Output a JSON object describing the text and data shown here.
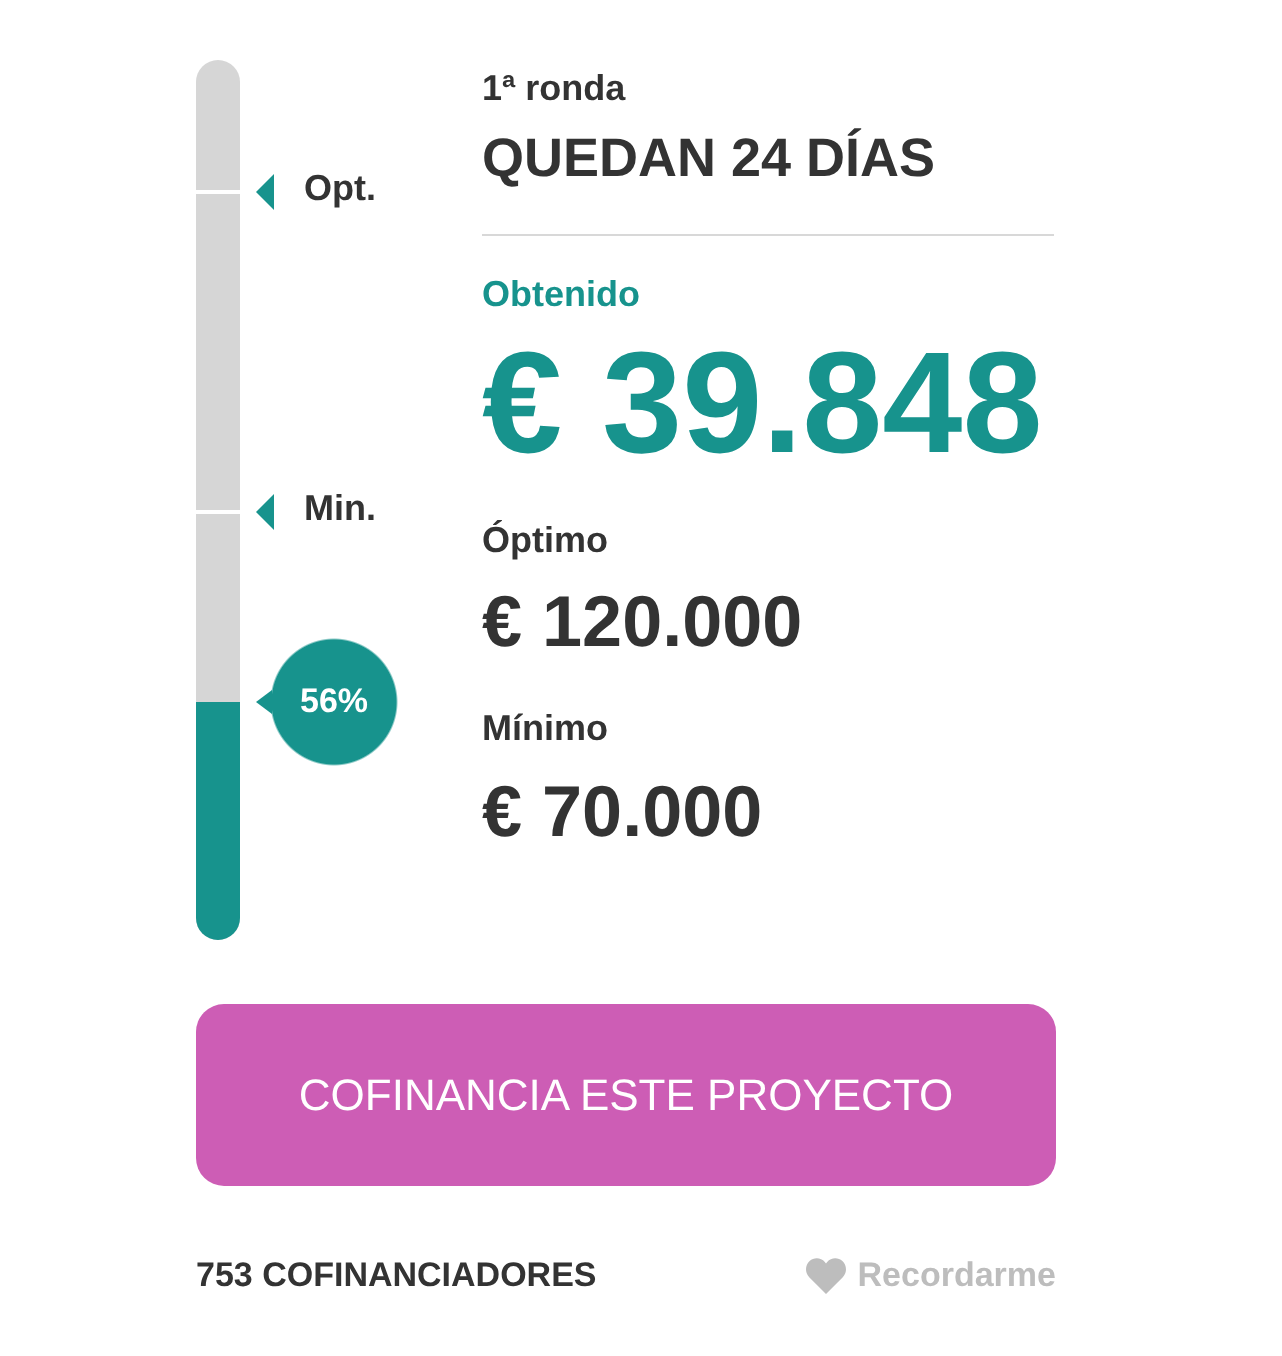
{
  "meter": {
    "level": 0.27,
    "percent": "56%",
    "markers": [
      {
        "label": "Opt."
      },
      {
        "label": "Min."
      }
    ]
  },
  "round": {
    "label": "1ª ronda",
    "remaining": "QUEDAN 24 DÍAS"
  },
  "raised": {
    "label": "Obtenido",
    "amount": "€ 39.848"
  },
  "goals": [
    {
      "label": "Óptimo",
      "amount": "€ 120.000"
    },
    {
      "label": "Mínimo",
      "amount": "€ 70.000"
    }
  ],
  "cta_button": "COFINANCIA ESTE PROYECTO",
  "backers": "753 COFINANCIADORES",
  "remember_link": "Recordarme"
}
